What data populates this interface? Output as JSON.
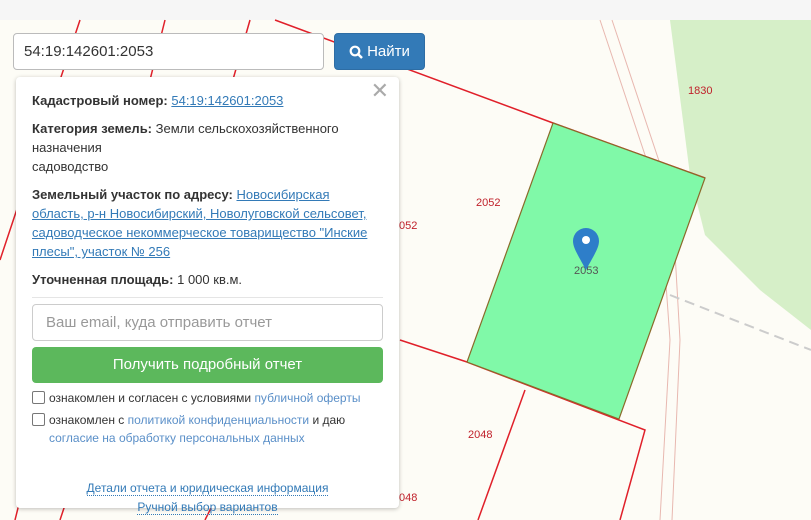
{
  "search": {
    "value": "54:19:142601:2053",
    "button_label": "Найти"
  },
  "panel": {
    "cadastral_label": "Кадастровый номер:",
    "cadastral_value": "54:19:142601:2053",
    "category_label": "Категория земель:",
    "category_value": "Земли сельскохозяйственного назначения",
    "usage": "садоводство",
    "address_label": "Земельный участок по адресу:",
    "address_value": "Новосибирская область, р-н Новосибирский, Новолуговской сельсовет, садоводческое некоммерческое товарищество \"Инские плесы\", участок № 256",
    "area_label": "Уточненная площадь:",
    "area_value": "1 000 кв.м.",
    "email_placeholder": "Ваш email, куда отправить отчет",
    "get_report": "Получить подробный отчет",
    "consent1_text": "ознакомлен и согласен с условиями ",
    "consent1_link": "публичной оферты",
    "consent2_text": "ознакомлен с ",
    "consent2_link": "политикой конфиденциальности",
    "consent2_mid": " и даю ",
    "consent2_link2": "согласие на обработку персональных данных",
    "details_link": "Детали отчета и юридическая информация",
    "manual_link": "Ручной выбор вариантов"
  },
  "map": {
    "labels": {
      "l1830": "1830",
      "l2052": "2052",
      "l2052b": "052",
      "l2053": "2053",
      "l2048": "2048",
      "l2048b": "048"
    },
    "parcel_color": "#80f9a8",
    "boundary_color": "#e0202a"
  }
}
